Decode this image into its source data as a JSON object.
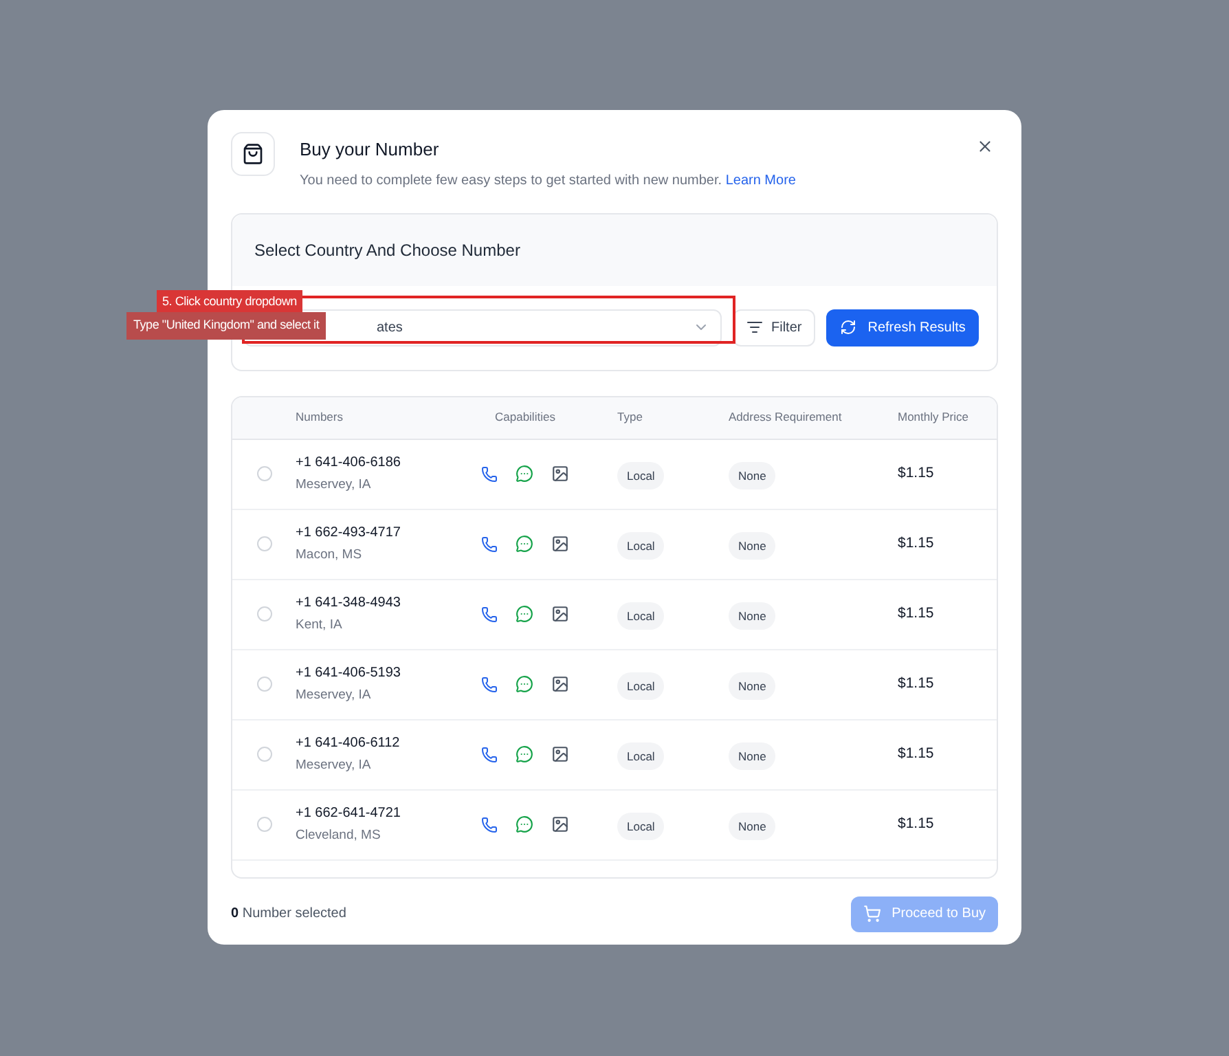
{
  "dialog": {
    "title": "Buy your Number",
    "subtitle": "You need to complete few easy steps to get started with new number.",
    "link": "Learn More"
  },
  "section": {
    "title": "Select Country And Choose Number",
    "country_value": "ates",
    "filter": "Filter",
    "refresh": "Refresh Results"
  },
  "annotation": {
    "step": "5. Click country dropdown",
    "hint": "Type \"United Kingdom\" and select it"
  },
  "table": {
    "columns": [
      "Numbers",
      "Capabilities",
      "Type",
      "Address Requirement",
      "Monthly Price"
    ],
    "rows": [
      {
        "number": "+1 641-406-6186",
        "location": "Meservey, IA",
        "type": "Local",
        "address": "None",
        "price": "$1.15",
        "selected": false
      },
      {
        "number": "+1 662-493-4717",
        "location": "Macon, MS",
        "type": "Local",
        "address": "None",
        "price": "$1.15",
        "selected": false
      },
      {
        "number": "+1 641-348-4943",
        "location": "Kent, IA",
        "type": "Local",
        "address": "None",
        "price": "$1.15",
        "selected": false
      },
      {
        "number": "+1 641-406-5193",
        "location": "Meservey, IA",
        "type": "Local",
        "address": "None",
        "price": "$1.15",
        "selected": false
      },
      {
        "number": "+1 641-406-6112",
        "location": "Meservey, IA",
        "type": "Local",
        "address": "None",
        "price": "$1.15",
        "selected": false
      },
      {
        "number": "+1 662-641-4721",
        "location": "Cleveland, MS",
        "type": "Local",
        "address": "None",
        "price": "$1.15",
        "selected": false
      }
    ]
  },
  "footer": {
    "count": "0",
    "count_label": "Number selected",
    "proceed": "Proceed to Buy",
    "proceed_disabled": true
  }
}
